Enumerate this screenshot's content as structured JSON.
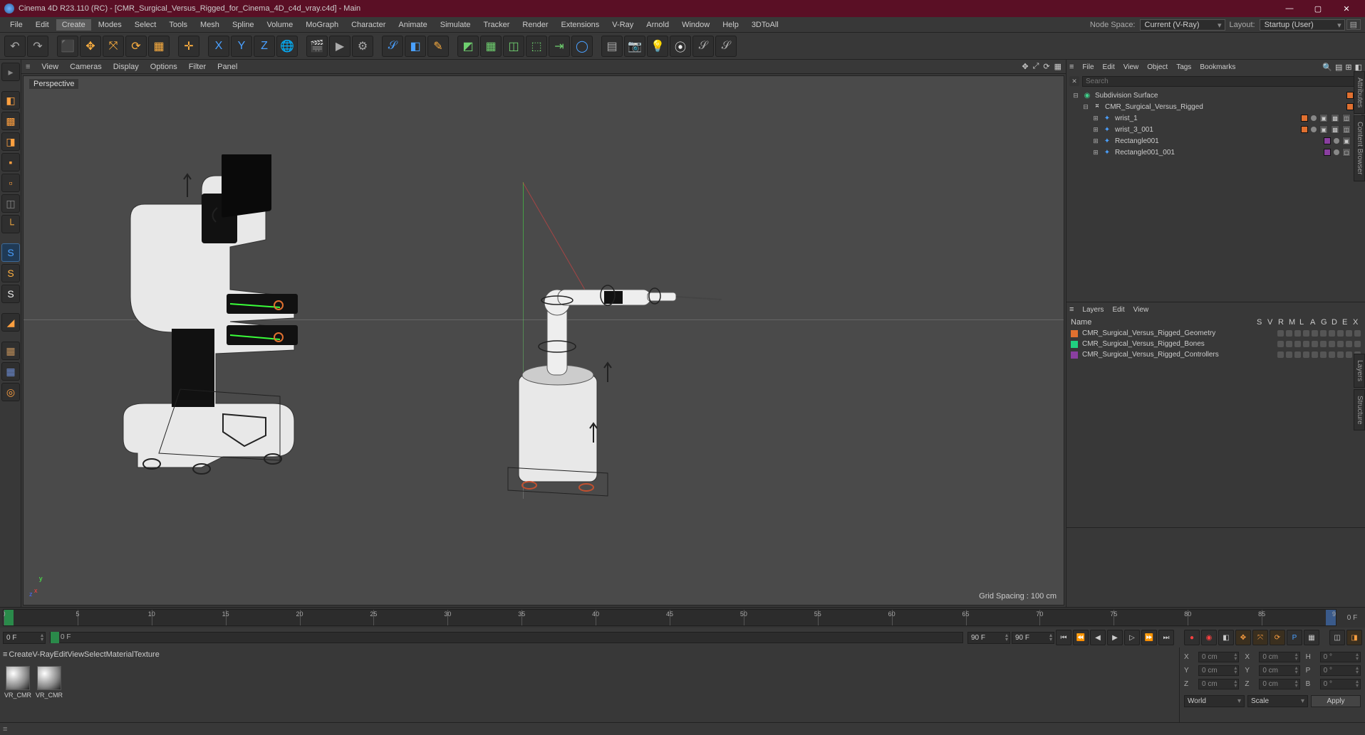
{
  "titlebar": {
    "app_title": "Cinema 4D R23.110 (RC) - [CMR_Surgical_Versus_Rigged_for_Cinema_4D_c4d_vray.c4d] - Main"
  },
  "menubar": {
    "items": [
      "File",
      "Edit",
      "Create",
      "Modes",
      "Select",
      "Tools",
      "Mesh",
      "Spline",
      "Volume",
      "MoGraph",
      "Character",
      "Animate",
      "Simulate",
      "Tracker",
      "Render",
      "Extensions",
      "V-Ray",
      "Arnold",
      "Window",
      "Help",
      "3DToAll"
    ],
    "active_index": 2,
    "right": {
      "nodespace_label": "Node Space:",
      "nodespace_value": "Current (V-Ray)",
      "layout_label": "Layout:",
      "layout_value": "Startup (User)"
    }
  },
  "viewmenu": {
    "items": [
      "View",
      "Cameras",
      "Display",
      "Options",
      "Filter",
      "Panel"
    ]
  },
  "viewport": {
    "label": "Perspective",
    "grid_spacing": "Grid Spacing : 100 cm"
  },
  "obj_panel": {
    "menu": [
      "File",
      "Edit",
      "View",
      "Object",
      "Tags",
      "Bookmarks"
    ],
    "search_placeholder": "Search"
  },
  "obj_tree": [
    {
      "name": "Subdivision Surface",
      "indent": 0,
      "expander": "⊟",
      "icon": "◉",
      "icon_color": "#3fd08a",
      "swatch": "#e07030",
      "dot": "#ff3030",
      "tags": []
    },
    {
      "name": "CMR_Surgical_Versus_Rigged",
      "indent": 1,
      "expander": "⊟",
      "icon": "⎶",
      "icon_color": "#ccc",
      "swatch": "#e07030",
      "dot": "#888",
      "tags": []
    },
    {
      "name": "wrist_1",
      "indent": 2,
      "expander": "⊞",
      "icon": "✦",
      "icon_color": "#4aa0ff",
      "swatch": "#e07030",
      "dot": "#888",
      "tags": [
        "▣",
        "▩",
        "◫",
        "•"
      ]
    },
    {
      "name": "wrist_3_001",
      "indent": 2,
      "expander": "⊞",
      "icon": "✦",
      "icon_color": "#4aa0ff",
      "swatch": "#e07030",
      "dot": "#888",
      "tags": [
        "▣",
        "▩",
        "◫",
        "•"
      ]
    },
    {
      "name": "Rectangle001",
      "indent": 2,
      "expander": "⊞",
      "icon": "✦",
      "icon_color": "#4aa0ff",
      "swatch": "#8a3fa0",
      "dot": "#888",
      "tags": [
        "▣",
        "•"
      ]
    },
    {
      "name": "Rectangle001_001",
      "indent": 2,
      "expander": "⊞",
      "icon": "✦",
      "icon_color": "#4aa0ff",
      "swatch": "#8a3fa0",
      "dot": "#888",
      "tags": [
        "▢",
        "•"
      ]
    }
  ],
  "layers_panel": {
    "menu": [
      "Layers",
      "Edit",
      "View"
    ],
    "header": {
      "name": "Name",
      "cols": [
        "S",
        "V",
        "R",
        "M",
        "L",
        "A",
        "G",
        "D",
        "E",
        "X"
      ]
    },
    "rows": [
      {
        "color": "#e07030",
        "name": "CMR_Surgical_Versus_Rigged_Geometry"
      },
      {
        "color": "#20d080",
        "name": "CMR_Surgical_Versus_Rigged_Bones"
      },
      {
        "color": "#8a3fa0",
        "name": "CMR_Surgical_Versus_Rigged_Controllers"
      }
    ]
  },
  "timeline": {
    "ticks": [
      0,
      5,
      10,
      15,
      20,
      25,
      30,
      35,
      40,
      45,
      50,
      55,
      60,
      65,
      70,
      75,
      80,
      85,
      90
    ],
    "end_label": "0 F",
    "frame_in": "0 F",
    "frame_cur": "0 F",
    "frame_out": "90 F",
    "frame_out2": "90 F"
  },
  "mat_menu": {
    "items": [
      "Create",
      "V-Ray",
      "Edit",
      "View",
      "Select",
      "Material",
      "Texture"
    ]
  },
  "materials": [
    {
      "name": "VR_CMR"
    },
    {
      "name": "VR_CMR"
    }
  ],
  "coords": {
    "X": "0 cm",
    "Y": "0 cm",
    "Z": "0 cm",
    "X2": "0 cm",
    "Y2": "0 cm",
    "Z2": "0 cm",
    "H": "0 °",
    "P": "0 °",
    "B": "0 °",
    "mode1": "World",
    "mode2": "Scale",
    "apply": "Apply"
  },
  "right_tabs": [
    "Attributes",
    "Content Browser",
    "Layers",
    "Structure"
  ]
}
